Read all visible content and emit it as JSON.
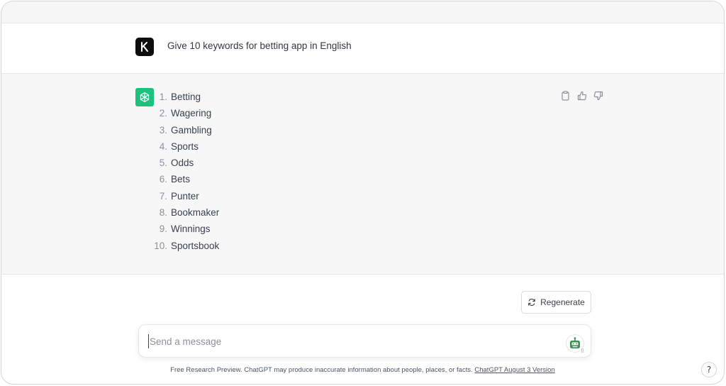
{
  "conversation": {
    "user_message": "Give 10 keywords for betting app in English",
    "assistant_list": [
      {
        "num": "1.",
        "text": "Betting"
      },
      {
        "num": "2.",
        "text": "Wagering"
      },
      {
        "num": "3.",
        "text": "Gambling"
      },
      {
        "num": "4.",
        "text": "Sports"
      },
      {
        "num": "5.",
        "text": "Odds"
      },
      {
        "num": "6.",
        "text": "Bets"
      },
      {
        "num": "7.",
        "text": "Punter"
      },
      {
        "num": "8.",
        "text": "Bookmaker"
      },
      {
        "num": "9.",
        "text": "Winnings"
      },
      {
        "num": "10.",
        "text": "Sportsbook"
      }
    ]
  },
  "user_avatar_letter": "K",
  "icons": {
    "user_avatar": "k-logo-icon",
    "assistant_avatar": "openai-logo-icon",
    "copy": "clipboard-icon",
    "like": "thumbs-up-icon",
    "dislike": "thumbs-down-icon",
    "regenerate": "refresh-icon",
    "send": "plugin-robot-icon"
  },
  "regenerate_label": "Regenerate",
  "composer": {
    "placeholder": "Send a message"
  },
  "footer": {
    "text": "Free Research Preview. ChatGPT may produce inaccurate information about people, places, or facts. ",
    "link": "ChatGPT August 3 Version"
  },
  "help_label": "?",
  "colors": {
    "assistant_avatar_bg": "#19c37d",
    "user_avatar_bg": "#0d0d0d",
    "assistant_row_bg": "#f7f7f8"
  }
}
